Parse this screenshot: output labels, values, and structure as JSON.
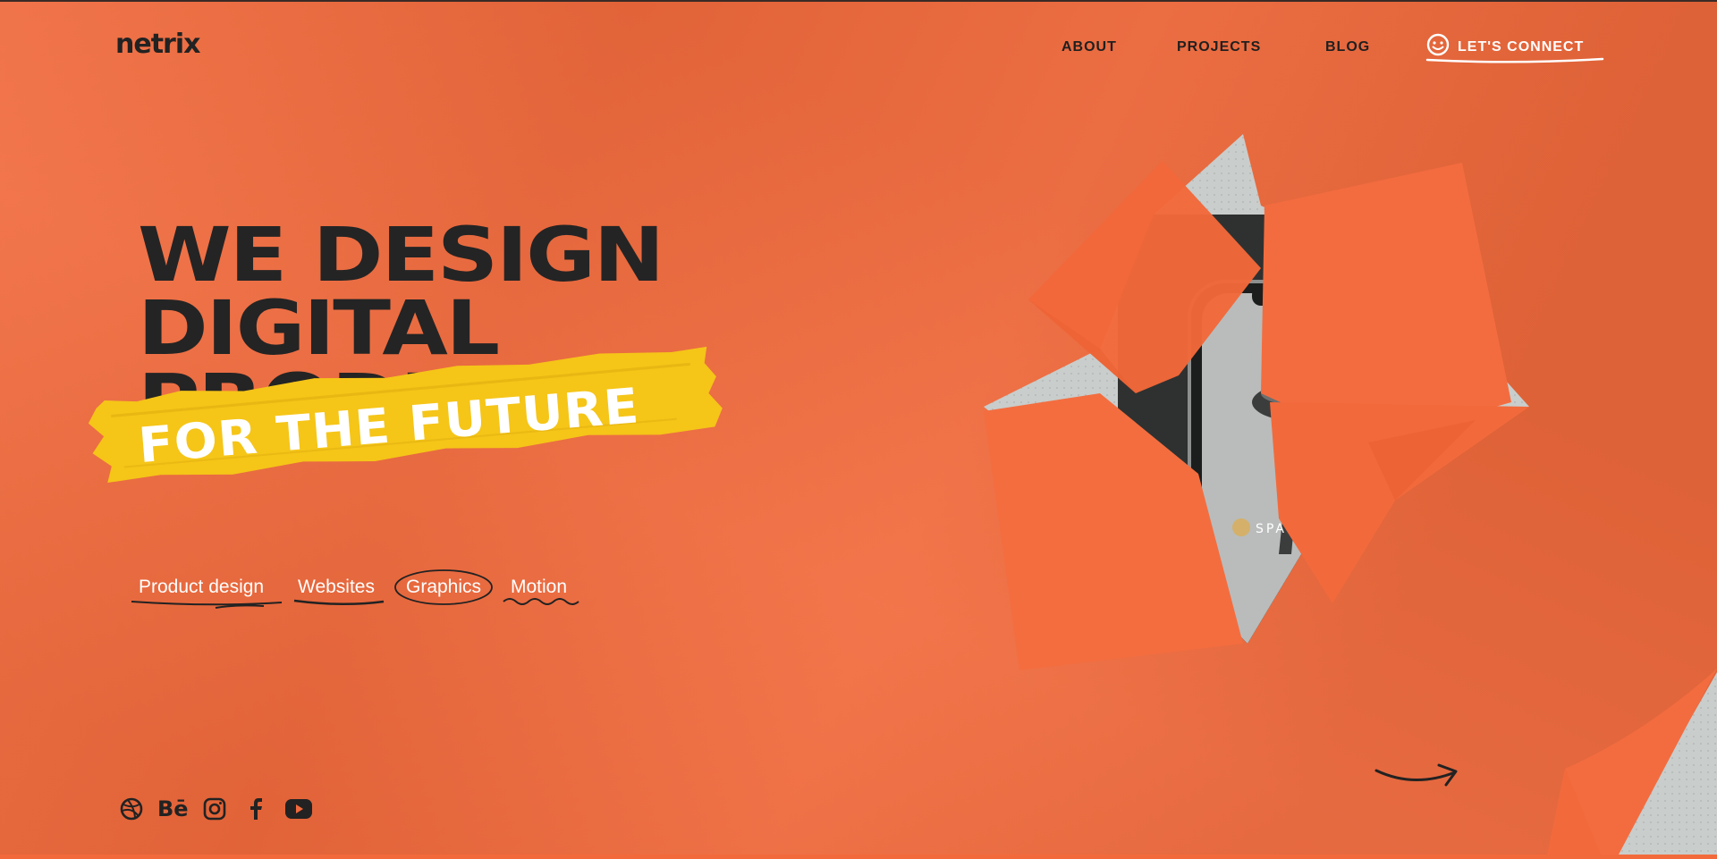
{
  "brand": {
    "logo_text": "netrix"
  },
  "nav": {
    "items": [
      {
        "label": "ABOUT"
      },
      {
        "label": "PROJECTS"
      },
      {
        "label": "BLOG"
      }
    ],
    "cta_label": "LET'S CONNECT"
  },
  "hero": {
    "lines": [
      "WE DESIGN",
      "DIGITAL",
      "PRODUCTS"
    ],
    "tape_text": "FOR THE FUTURE"
  },
  "categories": [
    {
      "label": "Product design"
    },
    {
      "label": "Websites"
    },
    {
      "label": "Graphics"
    },
    {
      "label": "Motion"
    }
  ],
  "social": [
    "dribbble-icon",
    "behance-icon",
    "instagram-icon",
    "facebook-icon",
    "youtube-icon"
  ],
  "colors": {
    "background": "#f26a3c",
    "text_dark": "#242424",
    "tape_yellow": "#f5c518",
    "white": "#ffffff"
  }
}
